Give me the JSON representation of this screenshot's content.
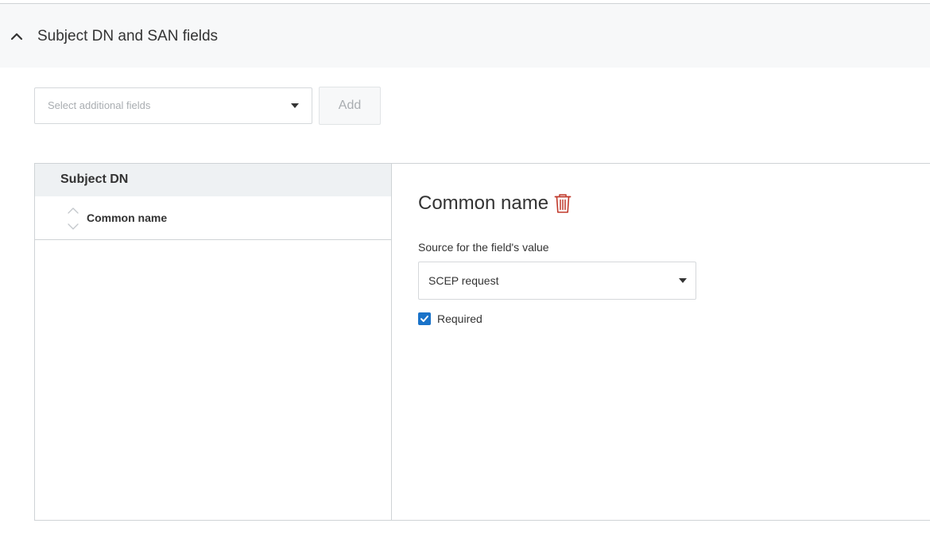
{
  "section": {
    "title": "Subject DN and SAN fields",
    "expanded": true
  },
  "toolbar": {
    "select_placeholder": "Select additional fields",
    "add_label": "Add"
  },
  "fields_list": {
    "group_label": "Subject DN",
    "items": [
      {
        "label": "Common name"
      }
    ]
  },
  "detail": {
    "title": "Common name",
    "source_label": "Source for the field's value",
    "source_value": "SCEP request",
    "required_label": "Required",
    "required_checked": true
  },
  "colors": {
    "accent": "#1a73c9",
    "delete": "#c0392b",
    "header_bg": "#f7f8f9",
    "selected_bg": "#eef1f3"
  }
}
